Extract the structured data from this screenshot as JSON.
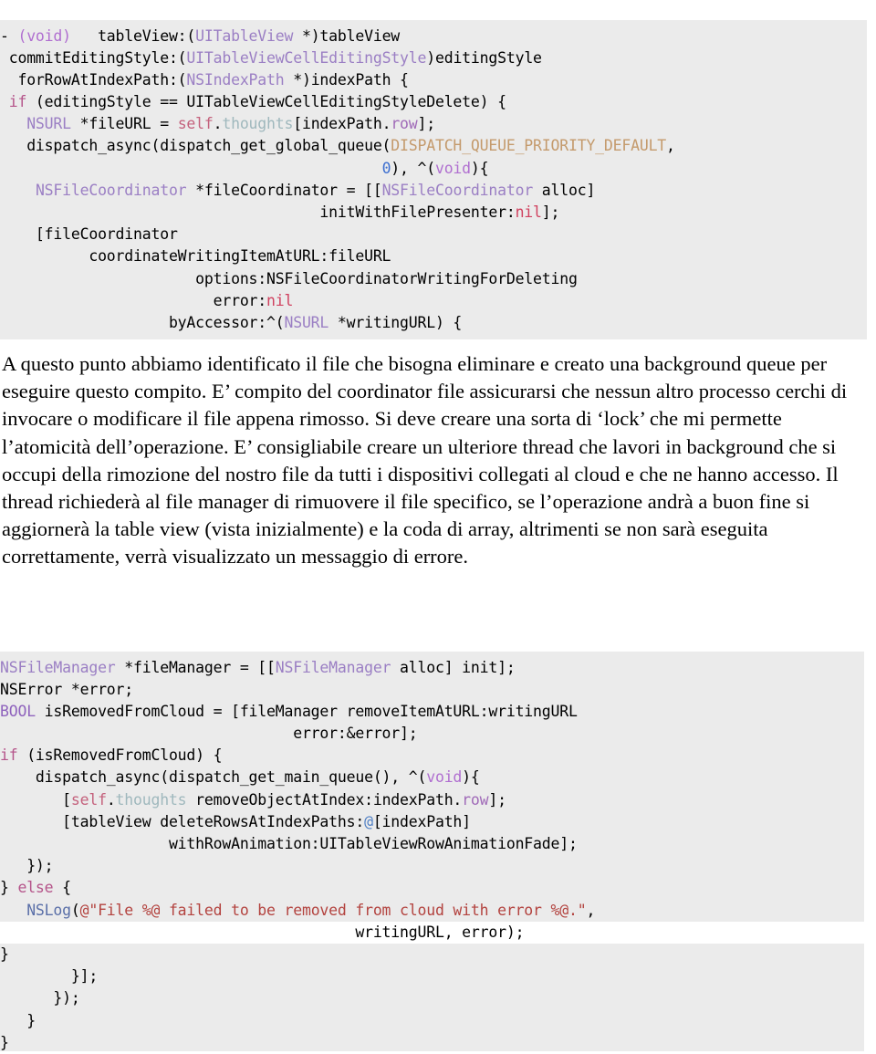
{
  "document": {
    "language": "it",
    "background_color": "#ffffff",
    "code_background_color": "#ebebeb"
  },
  "code_block_1": {
    "language": "objective-c",
    "lines": [
      [
        {
          "t": "- ",
          "c": "plain"
        },
        {
          "t": "(void)",
          "c": "void"
        },
        {
          "t": "   tableView:(",
          "c": "plain"
        },
        {
          "t": "UITableView",
          "c": "type"
        },
        {
          "t": " *)tableView",
          "c": "plain"
        }
      ],
      [
        {
          "t": " commitEditingStyle:(",
          "c": "plain"
        },
        {
          "t": "UITableViewCellEditingStyle",
          "c": "type"
        },
        {
          "t": ")editingStyle",
          "c": "plain"
        }
      ],
      [
        {
          "t": "  forRowAtIndexPath:(",
          "c": "plain"
        },
        {
          "t": "NSIndexPath",
          "c": "type"
        },
        {
          "t": " *)indexPath {",
          "c": "plain"
        }
      ],
      [
        {
          "t": " ",
          "c": "plain"
        },
        {
          "t": "if",
          "c": "keyword"
        },
        {
          "t": " (editingStyle == UITableViewCellEditingStyleDelete) {",
          "c": "plain"
        }
      ],
      [
        {
          "t": "   ",
          "c": "plain"
        },
        {
          "t": "NSURL",
          "c": "type"
        },
        {
          "t": " *fileURL = ",
          "c": "plain"
        },
        {
          "t": "self",
          "c": "self"
        },
        {
          "t": ".",
          "c": "plain"
        },
        {
          "t": "thoughts",
          "c": "prop"
        },
        {
          "t": "[indexPath.",
          "c": "plain"
        },
        {
          "t": "row",
          "c": "row"
        },
        {
          "t": "];",
          "c": "plain"
        }
      ],
      [
        {
          "t": "   dispatch_async(dispatch_get_global_queue(",
          "c": "plain"
        },
        {
          "t": "DISPATCH_QUEUE_PRIORITY_DEFAULT",
          "c": "const"
        },
        {
          "t": ",",
          "c": "plain"
        }
      ],
      [
        {
          "t": "                                           ",
          "c": "plain"
        },
        {
          "t": "0",
          "c": "num"
        },
        {
          "t": "), ^(",
          "c": "plain"
        },
        {
          "t": "void",
          "c": "void"
        },
        {
          "t": "){",
          "c": "plain"
        }
      ],
      [
        {
          "t": "    ",
          "c": "plain"
        },
        {
          "t": "NSFileCoordinator",
          "c": "type"
        },
        {
          "t": " *fileCoordinator = [[",
          "c": "plain"
        },
        {
          "t": "NSFileCoordinator",
          "c": "type"
        },
        {
          "t": " alloc]",
          "c": "plain"
        }
      ],
      [
        {
          "t": "                                    initWithFilePresenter:",
          "c": "plain"
        },
        {
          "t": "nil",
          "c": "nil"
        },
        {
          "t": "];",
          "c": "plain"
        }
      ],
      [
        {
          "t": "    [fileCoordinator",
          "c": "plain"
        }
      ],
      [
        {
          "t": "          coordinateWritingItemAtURL:fileURL",
          "c": "plain"
        }
      ],
      [
        {
          "t": "                      options:NSFileCoordinatorWritingForDeleting",
          "c": "plain"
        }
      ],
      [
        {
          "t": "                        error:",
          "c": "plain"
        },
        {
          "t": "nil",
          "c": "nil"
        }
      ],
      [
        {
          "t": "                   byAccessor:^(",
          "c": "plain"
        },
        {
          "t": "NSURL",
          "c": "type"
        },
        {
          "t": " *writingURL) {",
          "c": "plain"
        }
      ]
    ]
  },
  "prose": {
    "paragraphs": [
      "A questo punto abbiamo identificato il file che bisogna eliminare e creato una background queue per eseguire questo compito. E’ compito del coordinator file assicurarsi che nessun altro processo cerchi di invocare o modificare il file appena rimosso. Si deve creare una sorta di ‘lock’ che mi permette l’atomicità dell’operazione. E’ consigliabile creare un ulteriore thread che lavori in background che si occupi della rimozione del nostro file da tutti i dispositivi collegati al cloud e che ne hanno accesso. Il thread richiederà al file manager di rimuovere il file specifico, se l’operazione andrà a buon fine si aggiornerà la table view (vista inizialmente) e la coda di array, altrimenti se non sarà eseguita correttamente, verrà visualizzato un messaggio di errore."
    ]
  },
  "code_block_2": {
    "language": "objective-c",
    "lines": [
      [
        {
          "t": "NSFileManager",
          "c": "type"
        },
        {
          "t": " *fileManager = [[",
          "c": "plain"
        },
        {
          "t": "NSFileManager",
          "c": "type"
        },
        {
          "t": " alloc] init];",
          "c": "plain"
        }
      ],
      [
        {
          "t": "NSError *error;",
          "c": "plain"
        }
      ],
      [
        {
          "t": "BOOL",
          "c": "bool"
        },
        {
          "t": " isRemovedFromCloud = [fileManager removeItemAtURL:writingURL",
          "c": "plain"
        }
      ],
      [
        {
          "t": "                                 error:&error];",
          "c": "plain"
        }
      ],
      [
        {
          "t": "if",
          "c": "keyword"
        },
        {
          "t": " (isRemovedFromCloud) {",
          "c": "plain"
        }
      ],
      [
        {
          "t": "    dispatch_async(dispatch_get_main_queue(), ^(",
          "c": "plain"
        },
        {
          "t": "void",
          "c": "void"
        },
        {
          "t": "){",
          "c": "plain"
        }
      ],
      [
        {
          "t": "       [",
          "c": "plain"
        },
        {
          "t": "self",
          "c": "self"
        },
        {
          "t": ".",
          "c": "plain"
        },
        {
          "t": "thoughts",
          "c": "prop"
        },
        {
          "t": " removeObjectAtIndex:indexPath.",
          "c": "plain"
        },
        {
          "t": "row",
          "c": "row"
        },
        {
          "t": "];",
          "c": "plain"
        }
      ],
      [
        {
          "t": "       [tableView deleteRowsAtIndexPaths:",
          "c": "plain"
        },
        {
          "t": "@",
          "c": "at"
        },
        {
          "t": "[indexPath]",
          "c": "plain"
        }
      ],
      [
        {
          "t": "                   withRowAnimation:UITableViewRowAnimationFade];",
          "c": "plain"
        }
      ],
      [
        {
          "t": "   });",
          "c": "plain"
        }
      ],
      [
        {
          "t": "} ",
          "c": "plain"
        },
        {
          "t": "else",
          "c": "keyword"
        },
        {
          "t": " {",
          "c": "plain"
        }
      ],
      [
        {
          "t": "   ",
          "c": "plain"
        },
        {
          "t": "NSLog",
          "c": "fn"
        },
        {
          "t": "(",
          "c": "plain"
        },
        {
          "t": "@\"File %@ failed to be removed from cloud with error %@.\"",
          "c": "string"
        },
        {
          "t": ",",
          "c": "plain"
        }
      ],
      [
        {
          "t": "                                        writingURL, error);",
          "c": "plain"
        }
      ],
      [
        {
          "t": "}",
          "c": "plain"
        }
      ],
      [
        {
          "t": "        }];",
          "c": "plain"
        }
      ],
      [
        {
          "t": "      });",
          "c": "plain"
        }
      ],
      [
        {
          "t": "   }",
          "c": "plain"
        }
      ],
      [
        {
          "t": "}",
          "c": "plain"
        }
      ]
    ],
    "white_stripe_line_index": 12
  }
}
